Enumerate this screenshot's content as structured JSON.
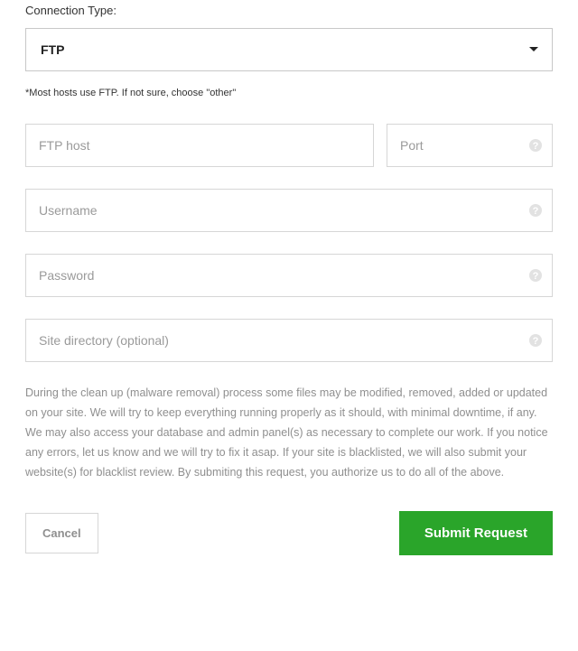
{
  "connection_type": {
    "label": "Connection Type:",
    "selected": "FTP",
    "hint": "*Most hosts use FTP. If not sure, choose \"other\""
  },
  "fields": {
    "ftp_host": {
      "placeholder": "FTP host",
      "value": ""
    },
    "port": {
      "placeholder": "Port",
      "value": ""
    },
    "username": {
      "placeholder": "Username",
      "value": ""
    },
    "password": {
      "placeholder": "Password",
      "value": ""
    },
    "site_directory": {
      "placeholder": "Site directory (optional)",
      "value": ""
    }
  },
  "disclosure": "During the clean up (malware removal) process some files may be modified, removed, added or updated on your site. We will try to keep everything running properly as it should, with minimal downtime, if any. We may also access your database and admin panel(s) as necessary to complete our work. If you notice any errors, let us know and we will try to fix it asap. If your site is blacklisted, we will also submit your website(s) for blacklist review. By submiting this request, you authorize us to do all of the above.",
  "buttons": {
    "cancel": "Cancel",
    "submit": "Submit Request"
  }
}
